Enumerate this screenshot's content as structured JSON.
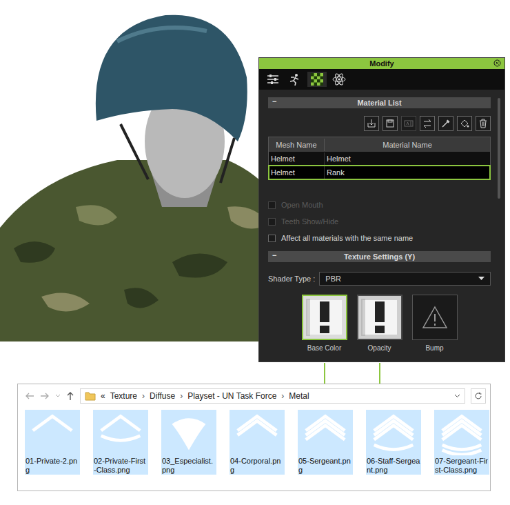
{
  "modify_panel": {
    "title": "Modify",
    "tabs": [
      {
        "selected": false
      },
      {
        "selected": false
      },
      {
        "selected": true
      },
      {
        "selected": false
      }
    ],
    "material_list": {
      "header": "Material List",
      "collapse": "−",
      "toolbar": [
        {
          "disabled": false
        },
        {
          "disabled": false
        },
        {
          "disabled": true
        },
        {
          "disabled": false
        },
        {
          "disabled": false
        },
        {
          "disabled": false
        },
        {
          "disabled": false
        }
      ],
      "columns": [
        "Mesh Name",
        "Material Name"
      ],
      "rows": [
        {
          "mesh": "Helmet",
          "material": "Helmet",
          "selected": false
        },
        {
          "mesh": "Helmet",
          "material": "Rank",
          "selected": true
        }
      ]
    },
    "options": [
      {
        "label": "Open Mouth",
        "checked": false,
        "disabled": true
      },
      {
        "label": "Teeth Show/Hide",
        "checked": false,
        "disabled": true
      },
      {
        "label": "Affect all materials with the same name",
        "checked": false,
        "disabled": false
      }
    ],
    "texture_settings": {
      "header": "Texture Settings (Y)",
      "collapse": "−",
      "shader_label": "Shader Type :",
      "shader": "PBR",
      "slots": [
        {
          "label": "Base Color",
          "selected": true,
          "kind": "texture"
        },
        {
          "label": "Opacity",
          "selected": false,
          "kind": "texture"
        },
        {
          "label": "Bump",
          "selected": false,
          "kind": "empty"
        }
      ]
    }
  },
  "explorer": {
    "overflow": "«",
    "separator": "›",
    "path": [
      "Texture",
      "Diffuse",
      "Playset - UN Task Force",
      "Metal"
    ],
    "files": [
      {
        "name": "01-Private-2.png",
        "selected": true
      },
      {
        "name": "02-Private-First-Class.png",
        "selected": true
      },
      {
        "name": "03_Especialist.png",
        "selected": true
      },
      {
        "name": "04-Corporal.png",
        "selected": true
      },
      {
        "name": "05-Sergeant.png",
        "selected": true
      },
      {
        "name": "06-Staff-Sergeant.png",
        "selected": true
      },
      {
        "name": "07-Sergeant-First-Class.png",
        "selected": true
      }
    ]
  }
}
